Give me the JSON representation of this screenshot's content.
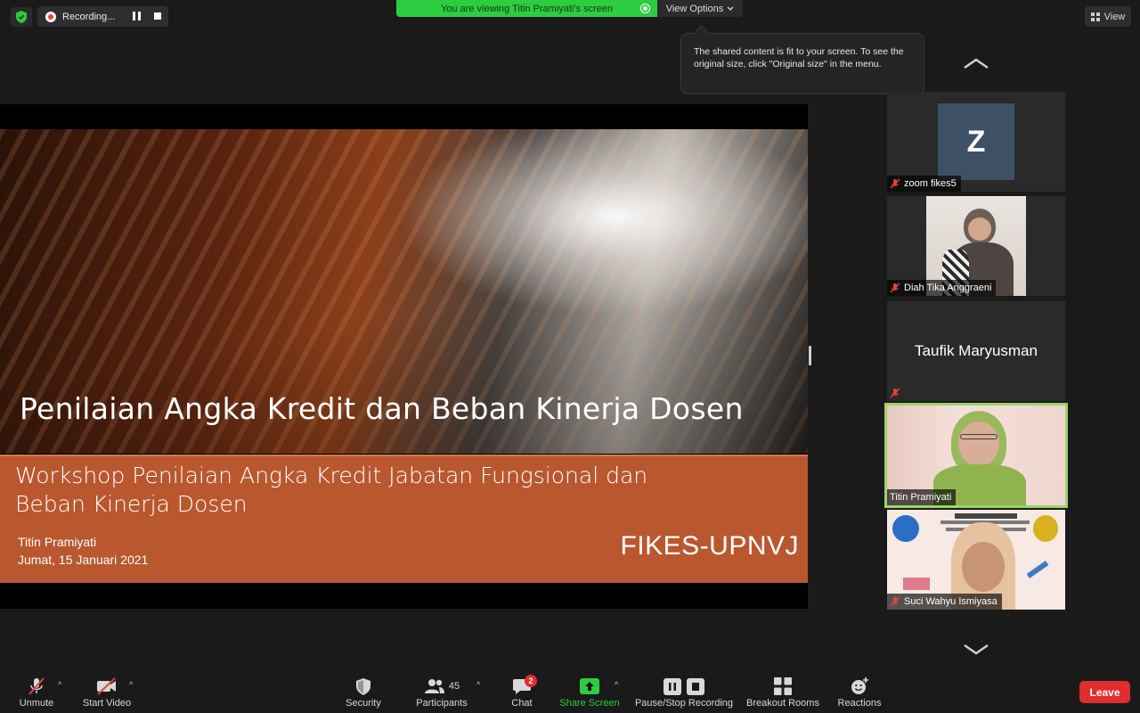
{
  "topbar": {
    "recording_label": "Recording...",
    "viewing_banner": "You are viewing Titin Pramiyati's screen",
    "view_options": "View Options",
    "view_button": "View"
  },
  "tooltip": {
    "text": "The shared content is fit to your screen. To see the original size, click \"Original size\" in the menu."
  },
  "slide": {
    "title": "Penilaian Angka Kredit dan Beban Kinerja Dosen",
    "subtitle": "Workshop Penilaian Angka Kredit Jabatan Fungsional dan Beban Kinerja Dosen",
    "author": "Titin Pramiyati",
    "date": "Jumat, 15 Januari 2021",
    "org": "FIKES-UPNVJ"
  },
  "participants": [
    {
      "name": "zoom fikes5",
      "avatar_letter": "Z",
      "muted": true
    },
    {
      "name": "Diah Tika Anggraeni",
      "muted": true
    },
    {
      "name": "Taufik Maryusman",
      "muted": true
    },
    {
      "name": "Titin Pramiyati",
      "muted": false,
      "active_speaker": true
    },
    {
      "name": "Suci Wahyu Ismiyasa",
      "muted": true
    }
  ],
  "toolbar": {
    "unmute": "Unmute",
    "start_video": "Start Video",
    "security": "Security",
    "participants": "Participants",
    "participants_count": "45",
    "chat": "Chat",
    "chat_badge": "2",
    "share_screen": "Share Screen",
    "pause_stop_recording": "Pause/Stop Recording",
    "breakout_rooms": "Breakout Rooms",
    "reactions": "Reactions",
    "leave": "Leave"
  },
  "colors": {
    "share_green": "#2ecc40",
    "slide_orange": "#b9582f",
    "leave_red": "#e02d2d",
    "active_border": "#9cd36b"
  }
}
